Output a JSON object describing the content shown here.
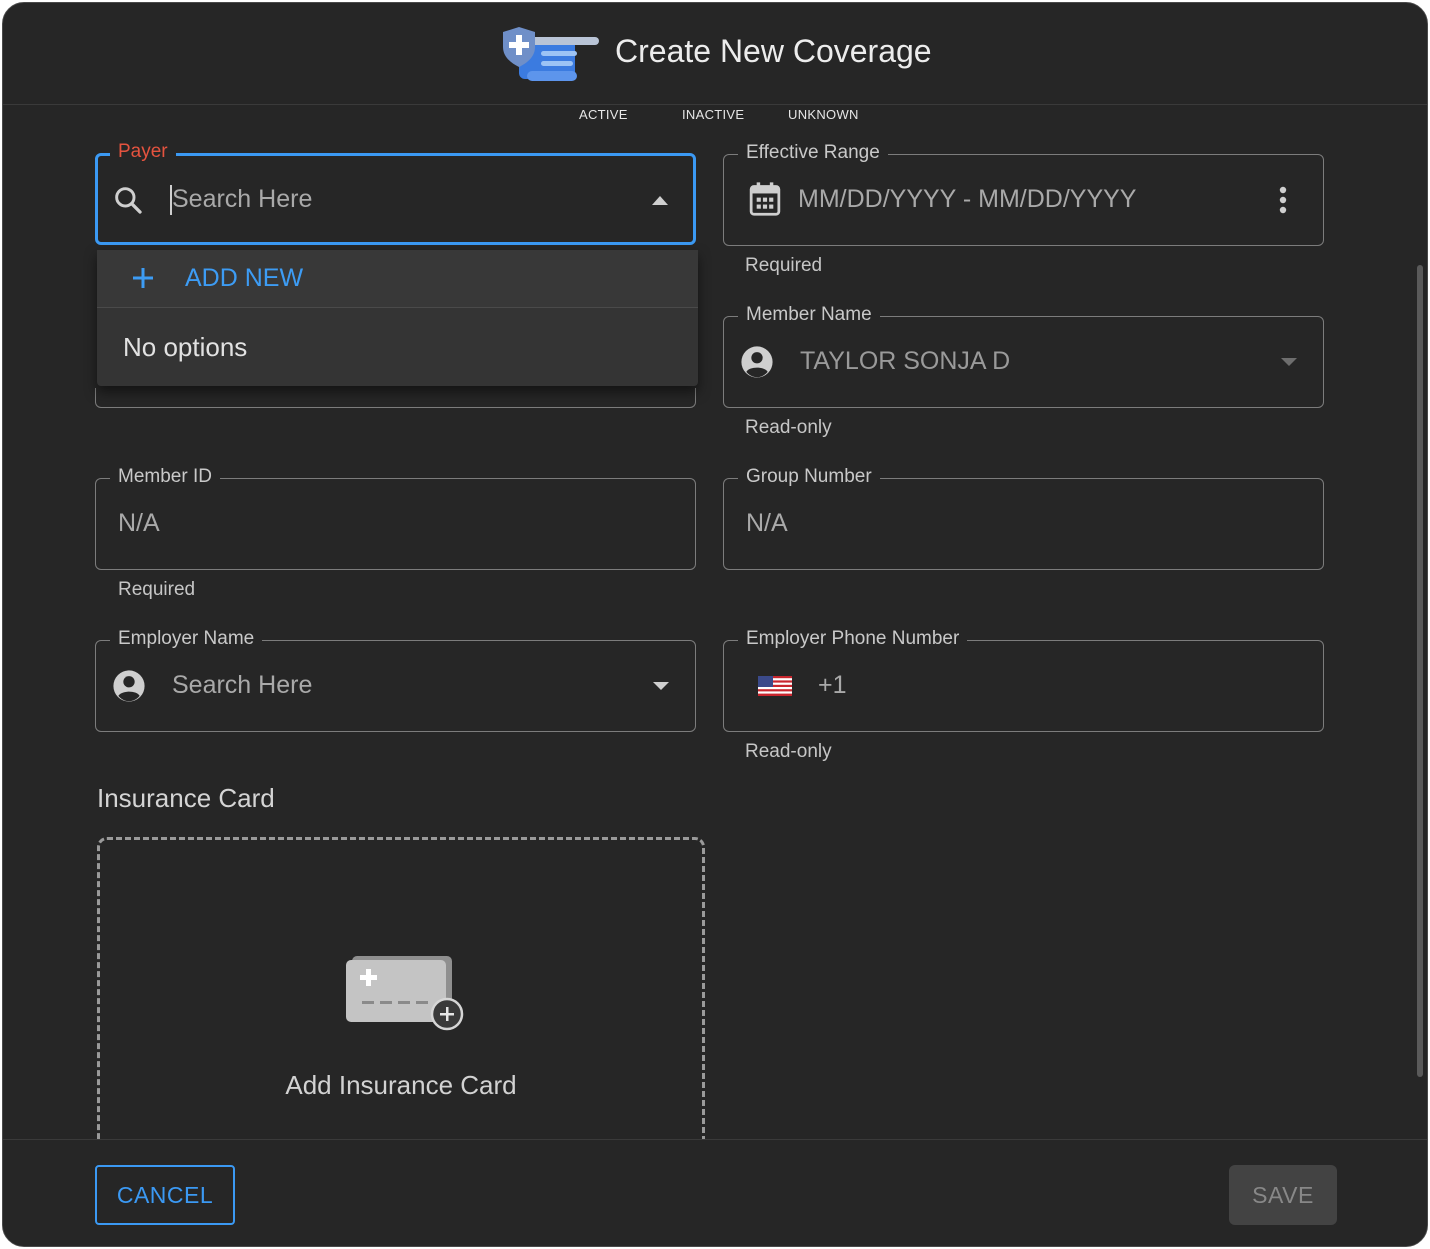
{
  "header": {
    "title": "Create New Coverage",
    "icon": "insurance-card-shield-icon"
  },
  "status_tabs": [
    "ACTIVE",
    "INACTIVE",
    "UNKNOWN"
  ],
  "payer": {
    "label": "Payer",
    "placeholder": "Search Here",
    "dropdown": {
      "add_new_label": "ADD NEW",
      "empty_text": "No options"
    }
  },
  "effective_range": {
    "label": "Effective Range",
    "placeholder": "MM/DD/YYYY - MM/DD/YYYY",
    "helper": "Required"
  },
  "member_name": {
    "label": "Member Name",
    "value": "TAYLOR SONJA D",
    "helper": "Read-only"
  },
  "member_id": {
    "label": "Member ID",
    "placeholder": "N/A",
    "helper": "Required"
  },
  "group_number": {
    "label": "Group Number",
    "placeholder": "N/A"
  },
  "employer_name": {
    "label": "Employer Name",
    "placeholder": "Search Here"
  },
  "employer_phone": {
    "label": "Employer Phone Number",
    "country_code": "+1",
    "helper": "Read-only"
  },
  "insurance_card": {
    "section_title": "Insurance Card",
    "add_label": "Add Insurance Card"
  },
  "footer": {
    "cancel_label": "CANCEL",
    "save_label": "SAVE"
  },
  "colors": {
    "accent": "#3b99f3",
    "error": "#e5533f",
    "background": "#262626"
  }
}
